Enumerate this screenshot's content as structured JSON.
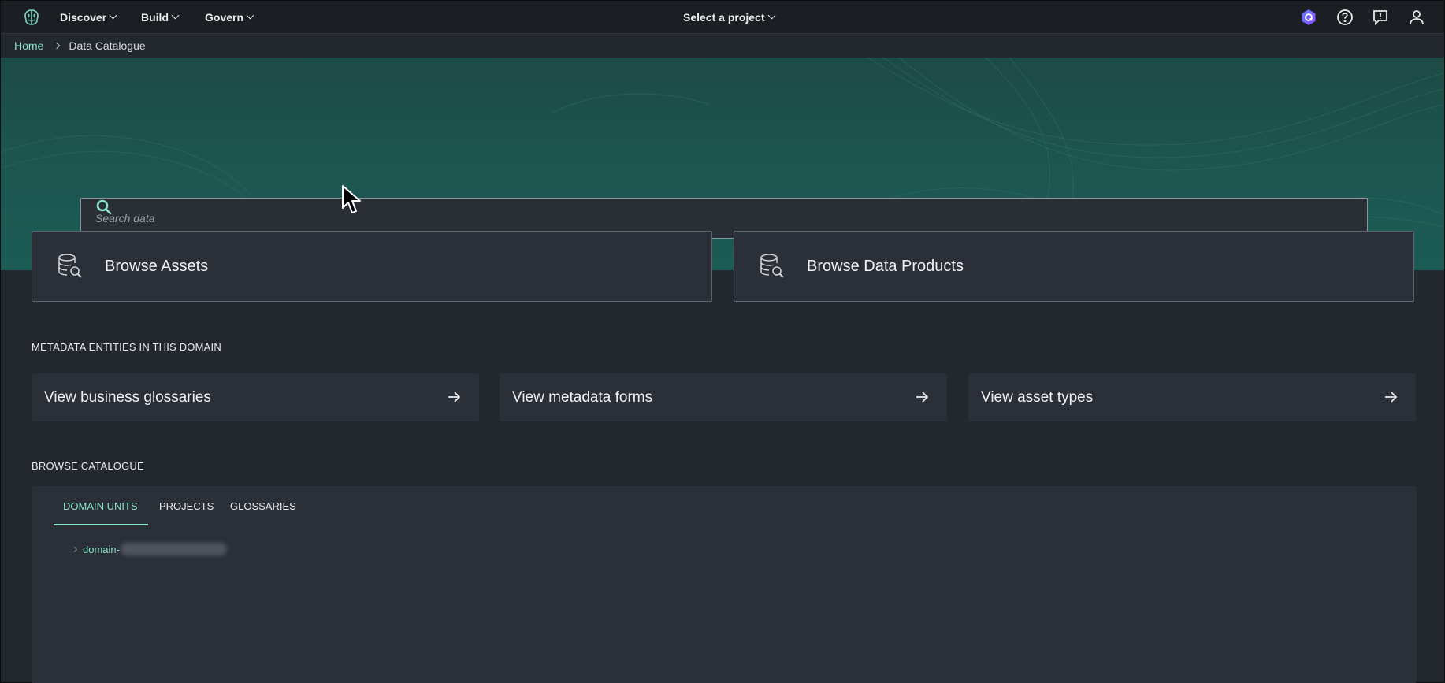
{
  "nav": {
    "menus": [
      {
        "label": "Discover",
        "icon": "chevron-down-icon"
      },
      {
        "label": "Build",
        "icon": "chevron-down-icon"
      },
      {
        "label": "Govern",
        "icon": "chevron-down-icon"
      }
    ],
    "project_selector": "Select a project",
    "right_icons": [
      "amazon-q-icon",
      "help-icon",
      "feedback-icon",
      "user-icon"
    ]
  },
  "breadcrumb": {
    "home": "Home",
    "current": "Data Catalogue"
  },
  "search": {
    "placeholder": "Search data"
  },
  "browse_cards": [
    {
      "label": "Browse Assets",
      "icon": "database-search-icon"
    },
    {
      "label": "Browse Data Products",
      "icon": "database-search-icon"
    }
  ],
  "metadata_section": {
    "title": "METADATA ENTITIES IN THIS DOMAIN",
    "cards": [
      {
        "label": "View business glossaries",
        "icon": "arrow-right-icon"
      },
      {
        "label": "View metadata forms",
        "icon": "arrow-right-icon"
      },
      {
        "label": "View asset types",
        "icon": "arrow-right-icon"
      }
    ]
  },
  "catalogue": {
    "title": "BROWSE CATALOGUE",
    "tabs": [
      {
        "label": "DOMAIN UNITS",
        "active": true
      },
      {
        "label": "PROJECTS",
        "active": false
      },
      {
        "label": "GLOSSARIES",
        "active": false
      }
    ],
    "tree": [
      {
        "label": "domain-"
      }
    ]
  },
  "colors": {
    "accent": "#89e3c8",
    "hero": "#1c5750",
    "background": "#23272e",
    "card": "#2b2f37"
  }
}
